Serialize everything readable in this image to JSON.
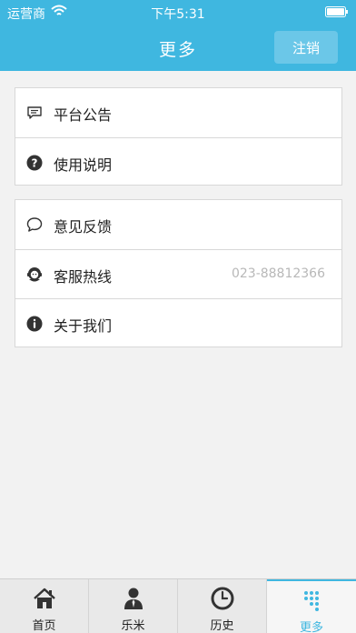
{
  "status_bar": {
    "carrier": "运营商",
    "time": "下午5:31"
  },
  "nav": {
    "title": "更多",
    "logout_label": "注销"
  },
  "groups": [
    {
      "items": [
        {
          "label": "平台公告",
          "icon": "message-icon"
        },
        {
          "label": "使用说明",
          "icon": "help-icon"
        }
      ]
    },
    {
      "items": [
        {
          "label": "意见反馈",
          "icon": "chat-bubble-icon"
        },
        {
          "label": "客服热线",
          "icon": "customer-service-icon",
          "value": "023-88812366"
        },
        {
          "label": "关于我们",
          "icon": "info-icon"
        }
      ]
    }
  ],
  "tabs": [
    {
      "label": "首页",
      "icon": "home-icon"
    },
    {
      "label": "乐米",
      "icon": "person-icon"
    },
    {
      "label": "历史",
      "icon": "clock-icon"
    },
    {
      "label": "更多",
      "icon": "dots-grid-icon",
      "active": true
    }
  ],
  "colors": {
    "accent": "#3fb7e0",
    "background": "#f2f2f2",
    "value_text": "#b8b8b8"
  }
}
